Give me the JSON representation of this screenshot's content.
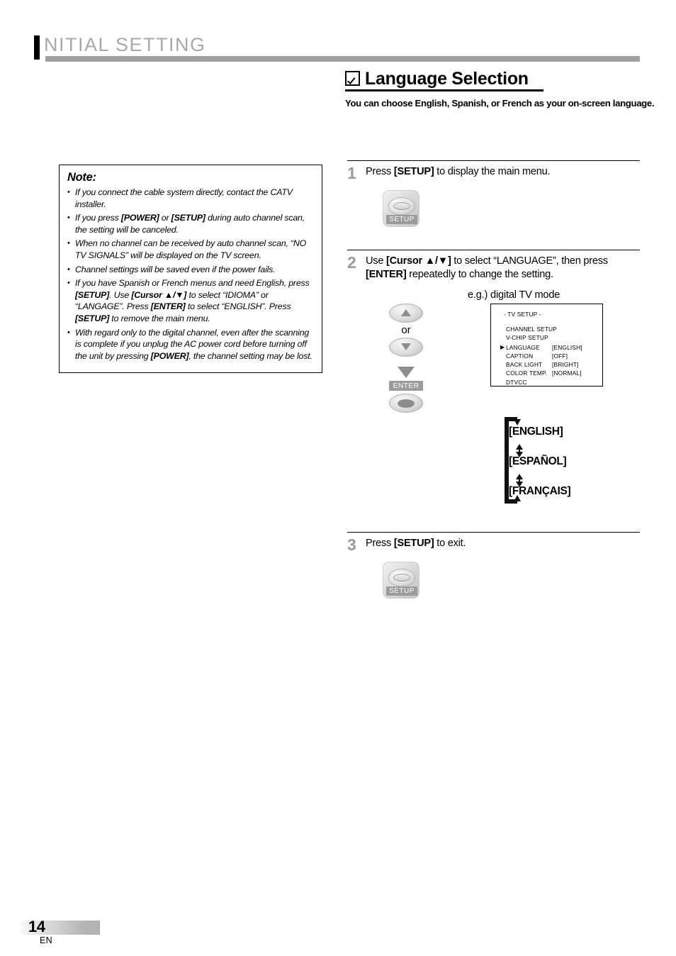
{
  "header": {
    "chapter_title": "NITIAL  SETTING"
  },
  "section": {
    "checkbox_icon": "checked-checkbox-icon",
    "title": "Language Selection",
    "subtitle": "You can choose English, Spanish, or French as your on-screen language."
  },
  "note": {
    "heading": "Note:",
    "bullet": "•",
    "items": [
      "If you connect the cable system directly, contact the CATV installer.",
      "If you press <b>[POWER]</b> or <b>[SETUP]</b> during auto channel scan, the setting will be canceled.",
      "When no channel can be received by auto channel scan, “NO TV SIGNALS” will be displayed on the TV screen.",
      "Channel settings will be saved even if the power fails.",
      "If you have Spanish or French menus and need English, press <b>[SETUP]</b>. Use <b>[Cursor ▲/▼]</b> to select “IDIOMA” or “LANGAGE”. Press <b>[ENTER]</b> to select “ENGLISH”. Press <b>[SETUP]</b> to remove the main menu.",
      "With regard only to the digital channel, even after the scanning is complete if you unplug the AC power cord before turning off the unit by pressing <b>[POWER]</b>, the channel setting may be lost."
    ]
  },
  "steps": [
    {
      "number": "1",
      "text": "Press <b>[SETUP]</b> to display the main menu."
    },
    {
      "number": "2",
      "text": "Use <b>[Cursor ▲/▼]</b> to select “LANGUAGE”, then press <b>[ENTER]</b> repeatedly to change the setting."
    },
    {
      "number": "3",
      "text": "Press <b>[SETUP]</b> to exit."
    }
  ],
  "remote": {
    "setup_button_label": "SETUP",
    "enter_button_label": "ENTER",
    "or_label": "or",
    "cursor_up_icon": "triangle-up-icon",
    "cursor_down_icon": "triangle-down-icon",
    "flow_arrow_icon": "triangle-down-arrow-icon"
  },
  "osd": {
    "caption": "e.g.) digital TV mode",
    "title": "-  TV SETUP   -",
    "cursor_marker": "▶",
    "rows": [
      {
        "cursor": "",
        "name": "CHANNEL SETUP",
        "value": ""
      },
      {
        "cursor": "",
        "name": "V-CHIP  SETUP",
        "value": ""
      },
      {
        "cursor": "▶",
        "name": "LANGUAGE",
        "value": "[ENGLISH]"
      },
      {
        "cursor": "",
        "name": "CAPTION",
        "value": "[OFF]"
      },
      {
        "cursor": "",
        "name": "BACK  LIGHT",
        "value": "[BRIGHT]"
      },
      {
        "cursor": "",
        "name": "COLOR  TEMP.",
        "value": "[NORMAL]"
      },
      {
        "cursor": "",
        "name": "DTVCC",
        "value": ""
      }
    ]
  },
  "language_cycle": {
    "options": [
      "[ENGLISH]",
      "[ESPAÑOL]",
      "[FRANÇAIS]"
    ]
  },
  "footer": {
    "page_number": "14",
    "language_code": "EN"
  },
  "colors": {
    "header_gray": "#a0a0a0",
    "step_number_gray": "#9a9a9a",
    "button_label_gray": "#9b9b9b"
  }
}
